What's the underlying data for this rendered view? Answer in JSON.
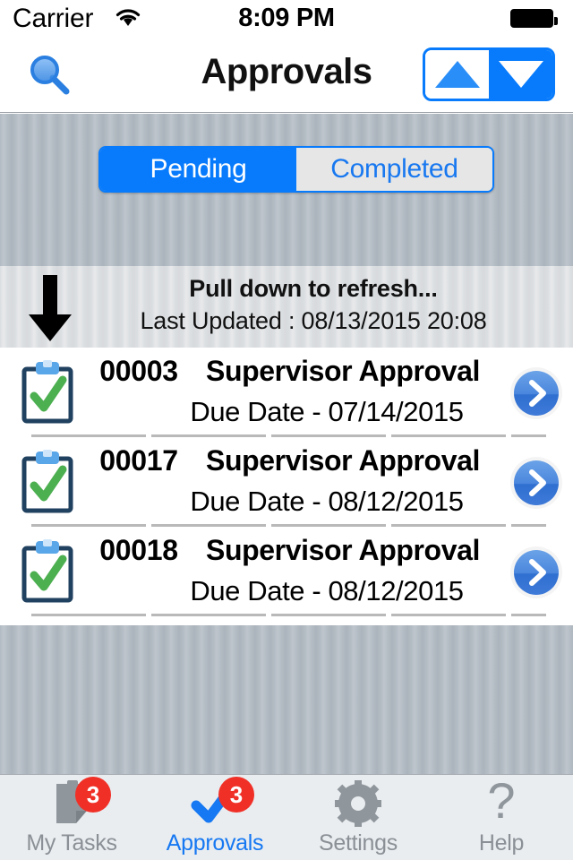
{
  "status_bar": {
    "carrier": "Carrier",
    "wifi_icon": "wifi-icon",
    "time": "8:09 PM",
    "battery_icon": "battery-full-icon"
  },
  "nav_bar": {
    "title": "Approvals",
    "search_icon": "search-icon",
    "stepper": {
      "up_icon": "triangle-up-icon",
      "down_icon": "triangle-down-icon"
    }
  },
  "segmented_control": {
    "selected": "Pending",
    "options": [
      {
        "label": "Pending",
        "selected": true
      },
      {
        "label": "Completed",
        "selected": false
      }
    ]
  },
  "pull_to_refresh": {
    "arrow_icon": "arrow-down-icon",
    "title": "Pull down to refresh...",
    "subtitle": "Last Updated : 08/13/2015 20:08"
  },
  "list": {
    "rows": [
      {
        "icon": "clipboard-check-icon",
        "id": "00003",
        "title": "Supervisor Approval",
        "due": "Due Date - 07/14/2015",
        "chevron": "chevron-right-icon"
      },
      {
        "icon": "clipboard-check-icon",
        "id": "00017",
        "title": "Supervisor Approval",
        "due": "Due Date - 08/12/2015",
        "chevron": "chevron-right-icon"
      },
      {
        "icon": "clipboard-check-icon",
        "id": "00018",
        "title": "Supervisor Approval",
        "due": "Due Date - 08/12/2015",
        "chevron": "chevron-right-icon"
      }
    ]
  },
  "tab_bar": {
    "tabs": [
      {
        "label": "My Tasks",
        "icon": "clipboard-icon",
        "badge": "3",
        "active": false
      },
      {
        "label": "Approvals",
        "icon": "checkmark-icon",
        "badge": "3",
        "active": true
      },
      {
        "label": "Settings",
        "icon": "gear-icon",
        "badge": "",
        "active": false
      },
      {
        "label": "Help",
        "icon": "question-mark-icon",
        "badge": "",
        "active": false
      }
    ]
  },
  "colors": {
    "accent_blue": "#077bfc",
    "badge_red": "#f03027",
    "inactive_gray": "#8a9096",
    "check_green": "#4caf50",
    "clipboard_navy": "#20415f"
  }
}
